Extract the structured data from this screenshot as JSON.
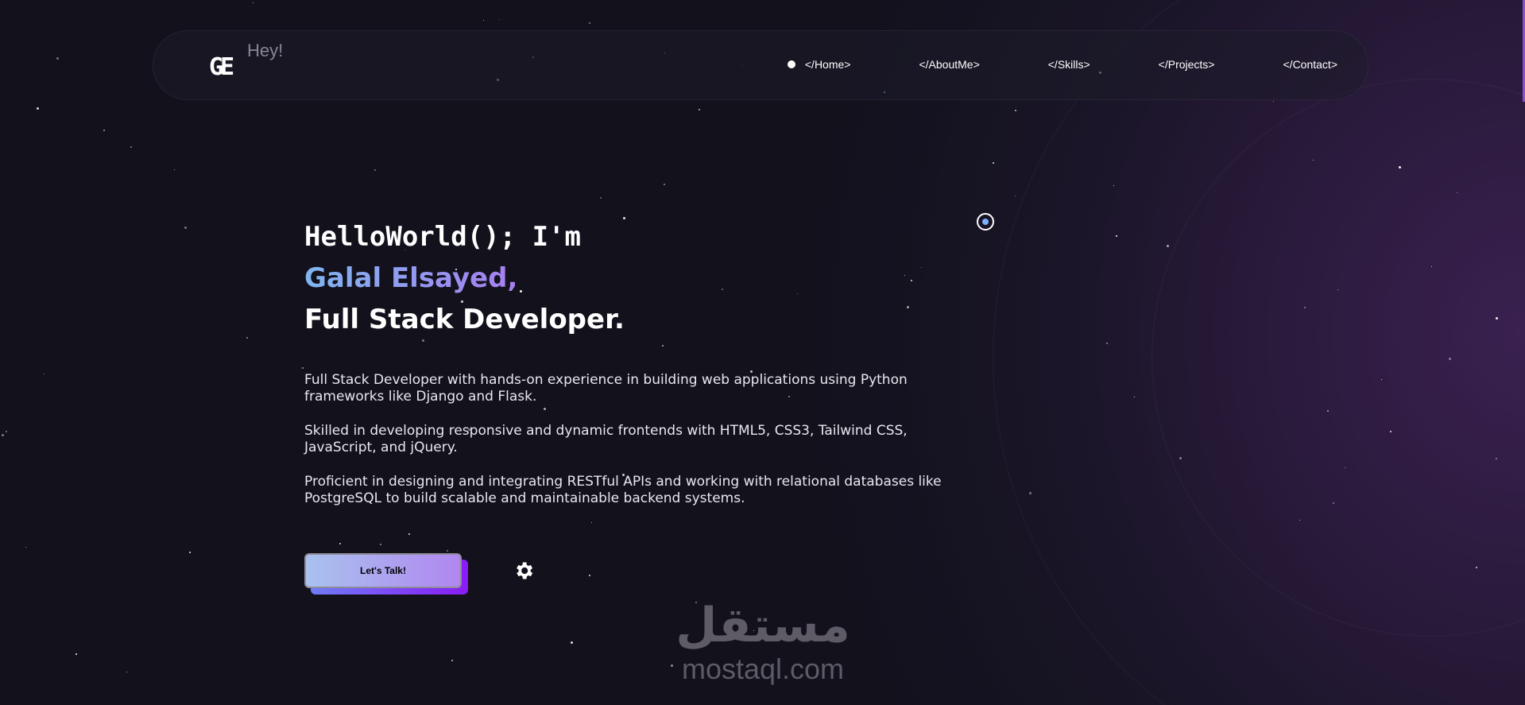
{
  "nav": {
    "logo": "GE",
    "logo_tag": "Hey!",
    "items": [
      {
        "label": "</Home>",
        "active": true
      },
      {
        "label": "</AboutMe>"
      },
      {
        "label": "</Skills>"
      },
      {
        "label": "</Projects>"
      },
      {
        "label": "</Contact>"
      }
    ]
  },
  "hero": {
    "line1": "HelloWorld(); I'm",
    "name": "Galal Elsayed,",
    "role": "Full Stack Developer.",
    "paragraphs": [
      "Full Stack Developer with hands-on experience in building web applications using Python frameworks like Django and Flask.",
      "Skilled in developing responsive and dynamic frontends with HTML5, CSS3, Tailwind CSS, JavaScript, and jQuery.",
      "Proficient in designing and integrating RESTful APIs and working with relational databases like PostgreSQL to build scalable and maintainable backend systems."
    ],
    "cta": "Let's Talk!"
  },
  "watermark": {
    "arabic": "مستقل",
    "latin": "mostaql.com"
  },
  "colors": {
    "background": "#12111c",
    "gradient_start": "#7fb6f0",
    "gradient_end": "#a77ef0",
    "accent": "#8a1bf5"
  }
}
